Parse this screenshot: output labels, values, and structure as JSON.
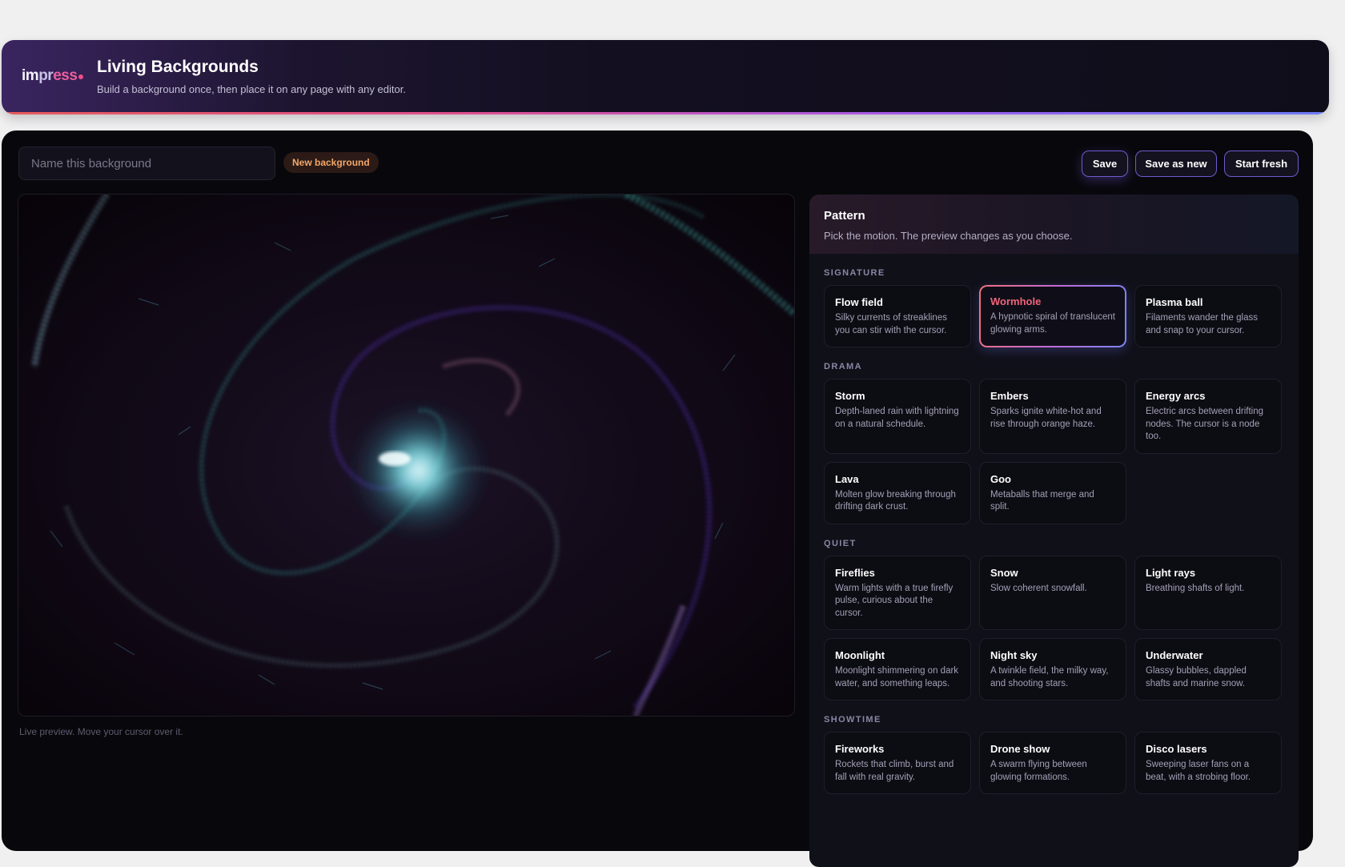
{
  "header": {
    "logo": {
      "part1": "im",
      "part2": "pr",
      "part3": "ess"
    },
    "title": "Living Backgrounds",
    "subtitle": "Build a background once, then place it on any page with any editor."
  },
  "editor": {
    "name_placeholder": "Name this background",
    "name_value": "",
    "status_badge": "New background",
    "buttons": {
      "save": "Save",
      "save_as_new": "Save as new",
      "start_fresh": "Start fresh"
    },
    "preview_caption": "Live preview. Move your cursor over it."
  },
  "pattern": {
    "title": "Pattern",
    "subtitle": "Pick the motion. The preview changes as you choose.",
    "selected": "Wormhole",
    "groups": [
      {
        "label": "SIGNATURE",
        "items": [
          {
            "name": "Flow field",
            "desc": "Silky currents of streaklines you can stir with the cursor."
          },
          {
            "name": "Wormhole",
            "desc": "A hypnotic spiral of translucent glowing arms."
          },
          {
            "name": "Plasma ball",
            "desc": "Filaments wander the glass and snap to your cursor."
          }
        ]
      },
      {
        "label": "DRAMA",
        "items": [
          {
            "name": "Storm",
            "desc": "Depth-laned rain with lightning on a natural schedule."
          },
          {
            "name": "Embers",
            "desc": "Sparks ignite white-hot and rise through orange haze."
          },
          {
            "name": "Energy arcs",
            "desc": "Electric arcs between drifting nodes. The cursor is a node too."
          },
          {
            "name": "Lava",
            "desc": "Molten glow breaking through drifting dark crust."
          },
          {
            "name": "Goo",
            "desc": "Metaballs that merge and split."
          }
        ]
      },
      {
        "label": "QUIET",
        "items": [
          {
            "name": "Fireflies",
            "desc": "Warm lights with a true firefly pulse, curious about the cursor."
          },
          {
            "name": "Snow",
            "desc": "Slow coherent snowfall."
          },
          {
            "name": "Light rays",
            "desc": "Breathing shafts of light."
          },
          {
            "name": "Moonlight",
            "desc": "Moonlight shimmering on dark water, and something leaps."
          },
          {
            "name": "Night sky",
            "desc": "A twinkle field, the milky way, and shooting stars."
          },
          {
            "name": "Underwater",
            "desc": "Glassy bubbles, dappled shafts and marine snow."
          }
        ]
      },
      {
        "label": "SHOWTIME",
        "items": [
          {
            "name": "Fireworks",
            "desc": "Rockets that climb, burst and fall with real gravity."
          },
          {
            "name": "Drone show",
            "desc": "A swarm flying between glowing formations."
          },
          {
            "name": "Disco lasers",
            "desc": "Sweeping laser fans on a beat, with a strobing floor."
          }
        ]
      }
    ]
  }
}
